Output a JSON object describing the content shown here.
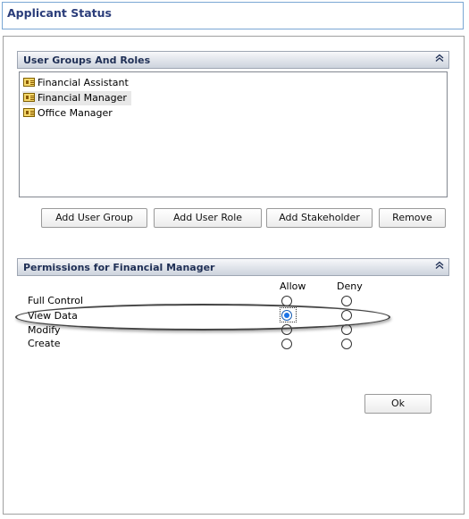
{
  "window": {
    "title": "Applicant Status"
  },
  "user_groups": {
    "header": "User Groups And Roles",
    "collapse_icon": "double-chevron-up-icon",
    "items": [
      {
        "label": "Financial Assistant",
        "selected": false
      },
      {
        "label": "Financial Manager",
        "selected": true
      },
      {
        "label": "Office Manager",
        "selected": false
      }
    ],
    "buttons": {
      "add_user_group": "Add User Group",
      "add_user_role": "Add User Role",
      "add_stakeholder": "Add Stakeholder",
      "remove": "Remove"
    }
  },
  "permissions": {
    "header": "Permissions for Financial Manager",
    "collapse_icon": "double-chevron-up-icon",
    "columns": [
      "Allow",
      "Deny"
    ],
    "rows": [
      {
        "label": "Full Control",
        "allow": false,
        "deny": false
      },
      {
        "label": "View Data",
        "allow": true,
        "deny": false
      },
      {
        "label": "Modify",
        "allow": false,
        "deny": false
      },
      {
        "label": "Create",
        "allow": false,
        "deny": false
      }
    ]
  },
  "ok_button": "Ok",
  "colors": {
    "title_text": "#2b3d7a",
    "title_border": "#7aa7d4",
    "radio_checked": "#1a73e8"
  }
}
